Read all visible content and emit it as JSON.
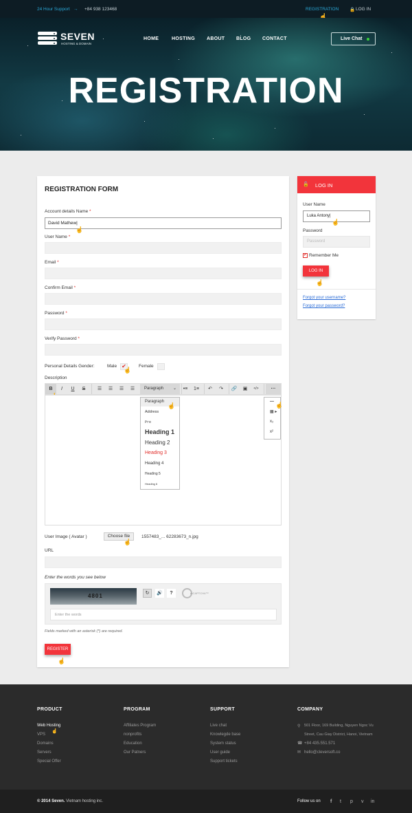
{
  "topbar": {
    "support_label": "24 Hour Support",
    "arrow": "→",
    "phone": "+84 938 123468",
    "registration": "REGISTRATION",
    "login": "LOG IN"
  },
  "brand": {
    "name": "SEVEN",
    "tagline": "HOSTING & DOMAIN"
  },
  "nav": [
    "HOME",
    "HOSTING",
    "ABOUT",
    "BLOG",
    "CONTACT"
  ],
  "live_chat": "Live Chat",
  "hero_title": "REGISTRATION",
  "form": {
    "title": "REGISTRATION FORM",
    "account_name_label": "Account details Name",
    "account_name_value": "David Mathew|",
    "username_label": "User Name",
    "email_label": "Email",
    "confirm_email_label": "Confirm Email",
    "password_label": "Password",
    "verify_password_label": "Verify Password",
    "asterisk": "*",
    "gender_label": "Personal Details Gender:",
    "male": "Male",
    "female": "Female",
    "male_checked": true,
    "description_label": "Description",
    "toolbar": {
      "bold": "B",
      "italic": "I",
      "underline": "U",
      "strike": "S",
      "format": "Paragraph",
      "more": "···"
    },
    "format_options": [
      "Paragraph",
      "Address",
      "Pre",
      "Heading 1",
      "Heading 2",
      "Heading 3",
      "Heading 4",
      "Heading 5",
      "Heading 6"
    ],
    "more_options": [
      "—",
      "▦ ▸",
      "x₂",
      "x²"
    ],
    "avatar_label": "User Image ( Avatar )",
    "choose_file": "Choose file",
    "file_name": "1557483_... 62283673_n.jpg",
    "url_label": "URL",
    "captcha_label": "Enter the words you see below",
    "captcha_text": "4801",
    "captcha_placeholder": "Enter the words",
    "captcha_brand": "reCAPTCHA™",
    "required_note": "Fields marked with an asterisk (*) are required.",
    "register": "REGISTER"
  },
  "login_box": {
    "title": "LOG IN",
    "username_label": "User Name",
    "username_value": "Luka Antony|",
    "password_label": "Password",
    "password_placeholder": "Password",
    "remember": "Remember Me",
    "button": "LOG IN",
    "forgot_username": "Forgot your username?",
    "forgot_password": "Forgot your password?"
  },
  "footer": {
    "product": {
      "title": "PRODUCT",
      "items": [
        "Web Hosting",
        "VPS",
        "Domains",
        "Servers",
        "Special Offer"
      ]
    },
    "program": {
      "title": "PROGRAM",
      "items": [
        "Affiliates Program",
        "nonprofits",
        "Education",
        "Our Patners"
      ]
    },
    "support": {
      "title": "SUPPORT",
      "items": [
        "Live chat",
        "Knowlegde base",
        "System status",
        "User guide",
        "Support tickets"
      ]
    },
    "company": {
      "title": "COMPANY",
      "address1": "501 Floor, 169 Building, Nguyen Ngoc Vu",
      "address2": "Street, Cau Giay District, Hanoi, Vietnam",
      "phone": "+84 435.551.571",
      "email": "hello@cleversoft.co"
    },
    "copyright_brand": "© 2014 Seven.",
    "copyright_rest": " Vietnam hosting inc.",
    "follow": "Follow us on",
    "social": [
      "f",
      "t",
      "p",
      "v",
      "in"
    ]
  },
  "colors": {
    "accent": "#f2343b",
    "topbar": "#0d1c24",
    "footer": "#2b2b2b",
    "link": "#2a6bd6",
    "support": "#2aa8d8"
  }
}
